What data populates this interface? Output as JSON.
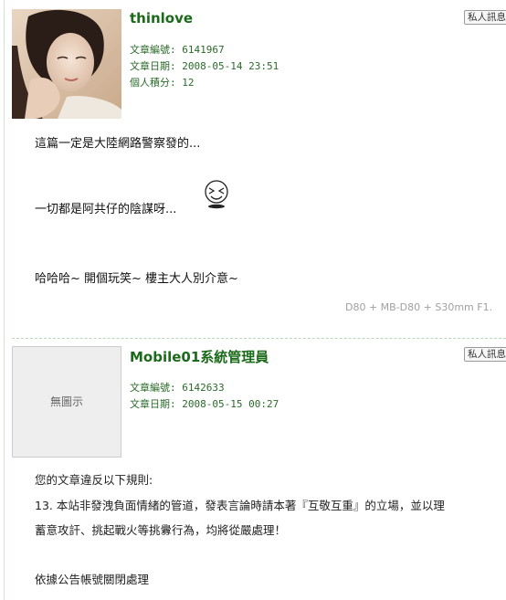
{
  "posts": [
    {
      "username": "thinlove",
      "pm_label": "私人訊息",
      "meta": [
        "文章編號: 6141967",
        "文章日期: 2008-05-14 23:51",
        "個人積分: 12"
      ],
      "body": [
        "這篇一定是大陸網路警察發的...",
        "一切都是阿共仔的陰謀呀...",
        "哈哈哈~ 開個玩笑~ 樓主大人別介意~"
      ],
      "signature": "D80 + MB-D80 + S30mm F1."
    },
    {
      "username": "Mobile01系統管理員",
      "pm_label": "私人訊息",
      "avatar_text": "無圖示",
      "meta": [
        "文章編號: 6142633",
        "文章日期: 2008-05-15 00:27"
      ],
      "body": [
        "您的文章違反以下規則:",
        "13. 本站非發洩負面情緒的管道，發表言論時請本著『互敬互重』的立場，並以理",
        "蓄意攻訐、挑起戰火等挑釁行為，均將從嚴處理！",
        "依據公告帳號關閉處理"
      ]
    }
  ],
  "colors": {
    "username": "#1a6a1a",
    "meta": "#2a6a2a",
    "divider": "#b7d7b7"
  },
  "icons": {
    "emoticon": "laughing-emoticon-icon",
    "avatar": "user-photo-avatar"
  }
}
